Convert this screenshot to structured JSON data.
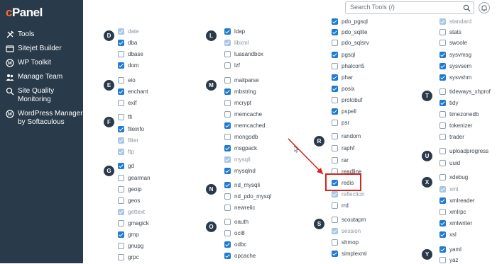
{
  "sidebar": {
    "logo": "cPanel",
    "items": [
      {
        "label": "Tools",
        "icon": "tools-icon"
      },
      {
        "label": "Sitejet Builder",
        "icon": "sitejet-icon"
      },
      {
        "label": "WP Toolkit",
        "icon": "wordpress-icon"
      },
      {
        "label": "Manage Team",
        "icon": "team-icon"
      },
      {
        "label": "Site Quality Monitoring",
        "icon": "site-quality-icon"
      },
      {
        "label": "WordPress Manager by Softaculous",
        "icon": "wordpress-manager-icon"
      }
    ]
  },
  "header": {
    "search_placeholder": "Search Tools (/)",
    "search_icon": "search-icon",
    "notification_icon": "bell-icon"
  },
  "letters": [
    "D",
    "E",
    "F",
    "G",
    "L",
    "M",
    "N",
    "O",
    "R",
    "S",
    "T",
    "U",
    "X",
    "Y"
  ],
  "extensions": {
    "col1": [
      {
        "name": "date",
        "checked": true,
        "disabled": true
      },
      {
        "name": "dba",
        "checked": true,
        "disabled": false
      },
      {
        "name": "dbase",
        "checked": false,
        "disabled": false
      },
      {
        "name": "dom",
        "checked": true,
        "disabled": false
      },
      {
        "name": "eio",
        "checked": false,
        "disabled": false
      },
      {
        "name": "enchant",
        "checked": true,
        "disabled": false
      },
      {
        "name": "exif",
        "checked": false,
        "disabled": false
      },
      {
        "name": "ffi",
        "checked": false,
        "disabled": false
      },
      {
        "name": "fileinfo",
        "checked": true,
        "disabled": false
      },
      {
        "name": "filter",
        "checked": true,
        "disabled": true
      },
      {
        "name": "ftp",
        "checked": true,
        "disabled": true
      },
      {
        "name": "gd",
        "checked": true,
        "disabled": false
      },
      {
        "name": "gearman",
        "checked": false,
        "disabled": false
      },
      {
        "name": "geoip",
        "checked": false,
        "disabled": false
      },
      {
        "name": "geos",
        "checked": false,
        "disabled": false
      },
      {
        "name": "gettext",
        "checked": true,
        "disabled": true
      },
      {
        "name": "gmagick",
        "checked": false,
        "disabled": false
      },
      {
        "name": "gmp",
        "checked": true,
        "disabled": false
      },
      {
        "name": "gnupg",
        "checked": false,
        "disabled": false
      },
      {
        "name": "grpc",
        "checked": false,
        "disabled": false
      }
    ],
    "col2": [
      {
        "name": "ldap",
        "checked": true,
        "disabled": false
      },
      {
        "name": "libxml",
        "checked": true,
        "disabled": true
      },
      {
        "name": "luasandbox",
        "checked": false,
        "disabled": false
      },
      {
        "name": "lzf",
        "checked": false,
        "disabled": false
      },
      {
        "name": "mailparse",
        "checked": false,
        "disabled": false
      },
      {
        "name": "mbstring",
        "checked": true,
        "disabled": false
      },
      {
        "name": "mcrypt",
        "checked": false,
        "disabled": false
      },
      {
        "name": "memcache",
        "checked": false,
        "disabled": false
      },
      {
        "name": "memcached",
        "checked": true,
        "disabled": false
      },
      {
        "name": "mongodb",
        "checked": false,
        "disabled": false
      },
      {
        "name": "msgpack",
        "checked": true,
        "disabled": false
      },
      {
        "name": "mysqli",
        "checked": true,
        "disabled": true
      },
      {
        "name": "mysqlnd",
        "checked": true,
        "disabled": false
      },
      {
        "name": "nd_mysqli",
        "checked": true,
        "disabled": false
      },
      {
        "name": "nd_pdo_mysql",
        "checked": false,
        "disabled": false
      },
      {
        "name": "newrelic",
        "checked": false,
        "disabled": false
      },
      {
        "name": "oauth",
        "checked": false,
        "disabled": false
      },
      {
        "name": "oci8",
        "checked": false,
        "disabled": false
      },
      {
        "name": "odbc",
        "checked": true,
        "disabled": false
      },
      {
        "name": "opcache",
        "checked": true,
        "disabled": false
      }
    ],
    "col3": [
      {
        "name": "pdo_pgsql",
        "checked": true,
        "disabled": false
      },
      {
        "name": "pdo_sqlite",
        "checked": true,
        "disabled": false
      },
      {
        "name": "pdo_sqlsrv",
        "checked": false,
        "disabled": false
      },
      {
        "name": "pgsql",
        "checked": true,
        "disabled": false
      },
      {
        "name": "phalcon5",
        "checked": false,
        "disabled": false
      },
      {
        "name": "phar",
        "checked": true,
        "disabled": false
      },
      {
        "name": "posix",
        "checked": true,
        "disabled": false
      },
      {
        "name": "protobuf",
        "checked": false,
        "disabled": false
      },
      {
        "name": "pspell",
        "checked": true,
        "disabled": false
      },
      {
        "name": "psr",
        "checked": false,
        "disabled": false
      },
      {
        "name": "random",
        "checked": false,
        "disabled": false
      },
      {
        "name": "raphf",
        "checked": false,
        "disabled": false
      },
      {
        "name": "rar",
        "checked": false,
        "disabled": false
      },
      {
        "name": "readline",
        "checked": false,
        "disabled": false
      },
      {
        "name": "redis",
        "checked": true,
        "disabled": false
      },
      {
        "name": "reflection",
        "checked": true,
        "disabled": true
      },
      {
        "name": "rrd",
        "checked": false,
        "disabled": false
      },
      {
        "name": "scoutapm",
        "checked": false,
        "disabled": false
      },
      {
        "name": "session",
        "checked": true,
        "disabled": true
      },
      {
        "name": "shmop",
        "checked": false,
        "disabled": false
      },
      {
        "name": "simplexml",
        "checked": true,
        "disabled": false
      }
    ],
    "col4": [
      {
        "name": "standard",
        "checked": true,
        "disabled": true
      },
      {
        "name": "stats",
        "checked": false,
        "disabled": false
      },
      {
        "name": "swoole",
        "checked": false,
        "disabled": false
      },
      {
        "name": "sysvmsg",
        "checked": true,
        "disabled": false
      },
      {
        "name": "sysvsem",
        "checked": true,
        "disabled": false
      },
      {
        "name": "sysvshm",
        "checked": true,
        "disabled": false
      },
      {
        "name": "tideways_xhprof",
        "checked": false,
        "disabled": false
      },
      {
        "name": "tidy",
        "checked": true,
        "disabled": false
      },
      {
        "name": "timezonedb",
        "checked": false,
        "disabled": false
      },
      {
        "name": "tokenizer",
        "checked": false,
        "disabled": false
      },
      {
        "name": "trader",
        "checked": false,
        "disabled": false
      },
      {
        "name": "uploadprogress",
        "checked": false,
        "disabled": false
      },
      {
        "name": "uuid",
        "checked": false,
        "disabled": false
      },
      {
        "name": "xdebug",
        "checked": false,
        "disabled": false
      },
      {
        "name": "xml",
        "checked": true,
        "disabled": true
      },
      {
        "name": "xmlreader",
        "checked": true,
        "disabled": false
      },
      {
        "name": "xmlrpc",
        "checked": false,
        "disabled": false
      },
      {
        "name": "xmlwriter",
        "checked": true,
        "disabled": false
      },
      {
        "name": "xsl",
        "checked": true,
        "disabled": false
      },
      {
        "name": "yaml",
        "checked": true,
        "disabled": false
      },
      {
        "name": "yaz",
        "checked": false,
        "disabled": false
      }
    ]
  },
  "colors": {
    "sidebar_bg": "#293a4a",
    "accent": "#1f7ad1",
    "highlight": "#d8231f",
    "logo_accent": "#ff6c2c"
  }
}
